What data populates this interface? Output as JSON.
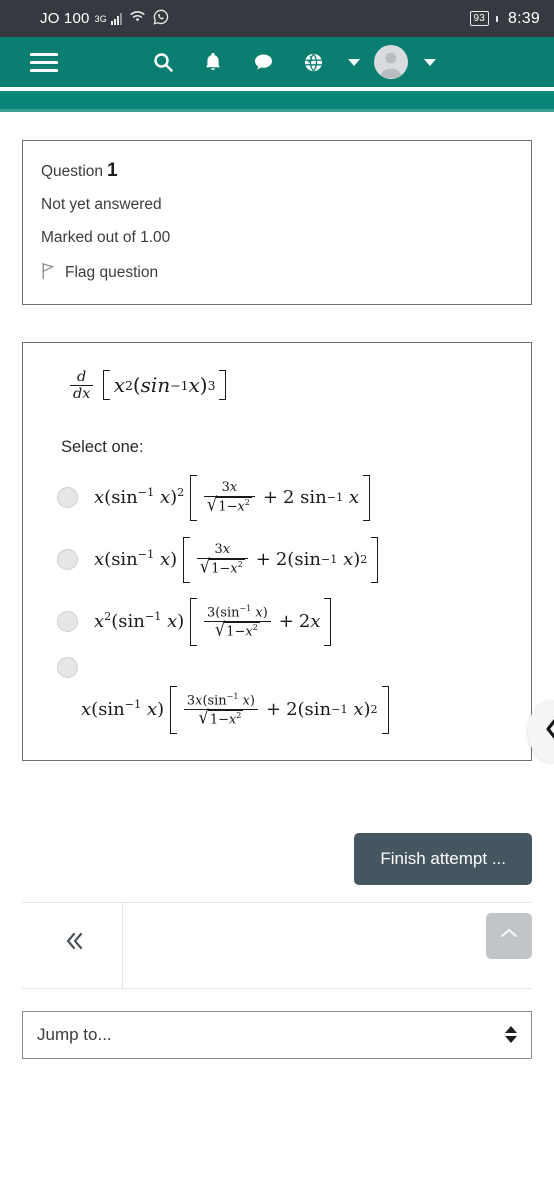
{
  "status_bar": {
    "carrier": "JO 100",
    "network_type": "3G",
    "battery_percent": "93",
    "time": "8:39",
    "icons": [
      "signal-bars-icon",
      "wifi-icon",
      "whatsapp-icon",
      "battery-icon"
    ]
  },
  "navbar": {
    "menu_icon": "hamburger-menu-icon",
    "icons": [
      "search-icon",
      "notification-bell-icon",
      "messages-icon",
      "language-globe-icon"
    ],
    "language_caret": "chevron-down-icon",
    "avatar": "user-avatar-icon",
    "user_caret": "chevron-down-icon"
  },
  "question_info": {
    "label": "Question",
    "number": "1",
    "state": "Not yet answered",
    "marks": "Marked out of 1.00",
    "flag_label": "Flag question",
    "flag_icon": "flag-outline-icon"
  },
  "question": {
    "stem_latex": "d/dx [ x^2 ( sin^{-1} x )^3 ]",
    "select_label": "Select one:",
    "options": [
      {
        "id": "a",
        "selected": false,
        "latex": "x(sin^{-1} x)^2 [ 3x/sqrt(1-x^2) + 2 sin^{-1} x ]"
      },
      {
        "id": "b",
        "selected": false,
        "latex": "x(sin^{-1} x) [ 3x/sqrt(1-x^2) + 2(sin^{-1} x)^2 ]"
      },
      {
        "id": "c",
        "selected": false,
        "latex": "x^2(sin^{-1} x) [ 3(sin^{-1} x)/sqrt(1-x^2) + 2x ]"
      },
      {
        "id": "d",
        "selected": false,
        "latex": "x(sin^{-1} x) [ 3x(sin^{-1} x)/sqrt(1-x^2) + 2(sin^{-1} x)^2 ]"
      }
    ]
  },
  "drawer": {
    "toggle_icon": "chevron-left-icon"
  },
  "actions": {
    "finish_attempt": "Finish attempt ..."
  },
  "bottom_nav": {
    "previous_icon": "double-chevron-left-icon",
    "scroll_top_icon": "chevron-up-icon"
  },
  "jump": {
    "label": "Jump to...",
    "icon": "updown-arrows-icon"
  },
  "colors": {
    "statusbar_bg": "#343a3f",
    "navbar_bg": "#0a7f71",
    "navbar_secondary": "#0a8577",
    "finish_button": "#465661",
    "card_border": "#6e7174",
    "scroll_top_bg": "#c2c5c7"
  }
}
